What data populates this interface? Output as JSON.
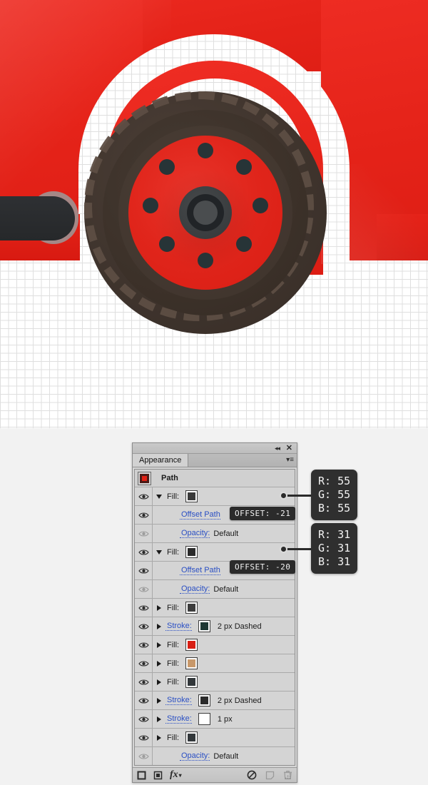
{
  "panel": {
    "titlebar": {
      "collapse_icon": "collapse-to-icons-icon",
      "collapse_glyph": "◂◂",
      "close_icon": "close-icon",
      "close_glyph": "✕"
    },
    "tab": {
      "label": "Appearance",
      "menu_icon": "panel-menu-icon",
      "menu_glyph": "▾≡"
    },
    "object": {
      "title": "Path",
      "thumbnail_icon": "path-thumbnail-icon"
    },
    "rows": [
      {
        "type": "fill",
        "eye": "on",
        "disclosure": "down",
        "label": "Fill:",
        "link": false,
        "swatch": "#3a3a3a",
        "info": "",
        "indent": false
      },
      {
        "type": "effect",
        "eye": "on",
        "disclosure": "none",
        "label": "Offset Path",
        "link": true,
        "swatch": "",
        "info": "",
        "indent": true
      },
      {
        "type": "opacity",
        "eye": "off",
        "disclosure": "none",
        "label": "Opacity:",
        "link": true,
        "swatch": "",
        "info": "Default",
        "indent": true
      },
      {
        "type": "fill",
        "eye": "on",
        "disclosure": "down",
        "label": "Fill:",
        "link": false,
        "swatch": "#2b2b2b",
        "info": "",
        "indent": false
      },
      {
        "type": "effect",
        "eye": "on",
        "disclosure": "none",
        "label": "Offset Path",
        "link": true,
        "swatch": "",
        "info": "",
        "indent": true
      },
      {
        "type": "opacity",
        "eye": "off",
        "disclosure": "none",
        "label": "Opacity:",
        "link": true,
        "swatch": "",
        "info": "Default",
        "indent": true
      },
      {
        "type": "fill",
        "eye": "on",
        "disclosure": "right",
        "label": "Fill:",
        "link": false,
        "swatch": "#3d3d3d",
        "info": "",
        "indent": false
      },
      {
        "type": "stroke",
        "eye": "on",
        "disclosure": "right",
        "label": "Stroke:",
        "link": true,
        "swatch": "#1e3733",
        "info": "2 px Dashed",
        "indent": false
      },
      {
        "type": "fill",
        "eye": "on",
        "disclosure": "right",
        "label": "Fill:",
        "link": false,
        "swatch": "#d81f14",
        "info": "",
        "indent": false
      },
      {
        "type": "fill",
        "eye": "on",
        "disclosure": "right",
        "label": "Fill:",
        "link": false,
        "swatch": "#c8986a",
        "info": "",
        "indent": false
      },
      {
        "type": "fill",
        "eye": "on",
        "disclosure": "right",
        "label": "Fill:",
        "link": false,
        "swatch": "#32373a",
        "info": "",
        "indent": false
      },
      {
        "type": "stroke",
        "eye": "on",
        "disclosure": "right",
        "label": "Stroke:",
        "link": true,
        "swatch": "#2b2b2b",
        "info": "2 px Dashed",
        "indent": false
      },
      {
        "type": "stroke",
        "eye": "on",
        "disclosure": "right",
        "label": "Stroke:",
        "link": true,
        "swatch": "#ffffff",
        "info": "1 px",
        "indent": false
      },
      {
        "type": "fill",
        "eye": "on",
        "disclosure": "right",
        "label": "Fill:",
        "link": false,
        "swatch": "#33383b",
        "info": "",
        "indent": false
      },
      {
        "type": "opacity",
        "eye": "off",
        "disclosure": "none",
        "label": "Opacity:",
        "link": true,
        "swatch": "",
        "info": "Default",
        "indent": true
      }
    ],
    "footer": {
      "buttons": [
        {
          "name": "add-new-fill-button",
          "icon": "new-fill-icon"
        },
        {
          "name": "add-new-stroke-button",
          "icon": "new-stroke-icon"
        },
        {
          "name": "add-new-effect-button",
          "icon": "fx-icon",
          "glyph": "fx"
        }
      ],
      "buttons_right": [
        {
          "name": "clear-appearance-button",
          "icon": "clear-appearance-icon"
        },
        {
          "name": "duplicate-item-button",
          "icon": "duplicate-icon"
        },
        {
          "name": "delete-item-button",
          "icon": "trash-icon"
        }
      ],
      "resize_grip_icon": "resize-grip-icon"
    }
  },
  "callouts": [
    {
      "name": "offset-callout-top",
      "text": "OFFSET: -21"
    },
    {
      "name": "offset-callout-bottom",
      "text": "OFFSET: -20"
    }
  ],
  "color_tooltips": [
    {
      "name": "rgb-tooltip-top",
      "r": "R: 55",
      "g": "G: 55",
      "b": "B: 55",
      "hex": "#373737"
    },
    {
      "name": "rgb-tooltip-bottom",
      "r": "R: 31",
      "g": "G: 31",
      "b": "B: 31",
      "hex": "#1f1f1f"
    }
  ],
  "artwork": {
    "name": "car-wheel-illustration",
    "colors": {
      "body_red": "#e52319",
      "tire_brown": "#3f342d",
      "tread_brown": "#5d4e44",
      "rim_red": "#e0251b",
      "lug_dark": "#273437",
      "hub_gray": "#4a4d4f",
      "bumper_dark": "#2e3033",
      "grid_line": "#dfdfdf"
    }
  }
}
